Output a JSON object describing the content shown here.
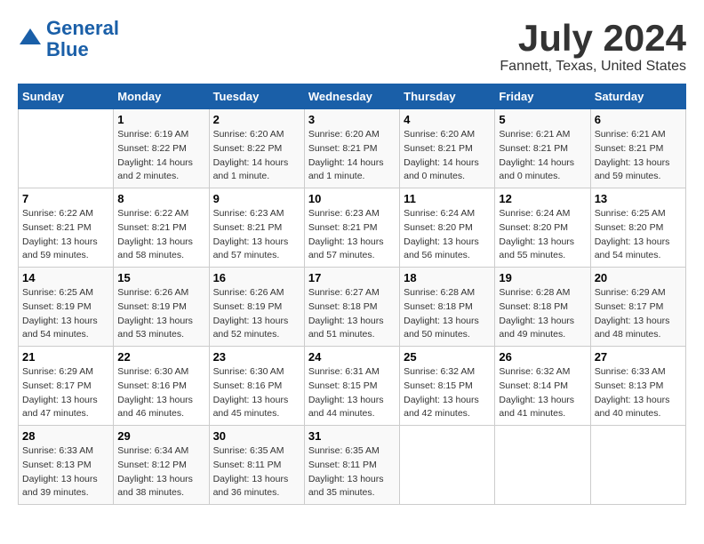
{
  "logo": {
    "line1": "General",
    "line2": "Blue"
  },
  "title": "July 2024",
  "subtitle": "Fannett, Texas, United States",
  "days_of_week": [
    "Sunday",
    "Monday",
    "Tuesday",
    "Wednesday",
    "Thursday",
    "Friday",
    "Saturday"
  ],
  "weeks": [
    [
      {
        "num": "",
        "info": ""
      },
      {
        "num": "1",
        "info": "Sunrise: 6:19 AM\nSunset: 8:22 PM\nDaylight: 14 hours\nand 2 minutes."
      },
      {
        "num": "2",
        "info": "Sunrise: 6:20 AM\nSunset: 8:22 PM\nDaylight: 14 hours\nand 1 minute."
      },
      {
        "num": "3",
        "info": "Sunrise: 6:20 AM\nSunset: 8:21 PM\nDaylight: 14 hours\nand 1 minute."
      },
      {
        "num": "4",
        "info": "Sunrise: 6:20 AM\nSunset: 8:21 PM\nDaylight: 14 hours\nand 0 minutes."
      },
      {
        "num": "5",
        "info": "Sunrise: 6:21 AM\nSunset: 8:21 PM\nDaylight: 14 hours\nand 0 minutes."
      },
      {
        "num": "6",
        "info": "Sunrise: 6:21 AM\nSunset: 8:21 PM\nDaylight: 13 hours\nand 59 minutes."
      }
    ],
    [
      {
        "num": "7",
        "info": "Sunrise: 6:22 AM\nSunset: 8:21 PM\nDaylight: 13 hours\nand 59 minutes."
      },
      {
        "num": "8",
        "info": "Sunrise: 6:22 AM\nSunset: 8:21 PM\nDaylight: 13 hours\nand 58 minutes."
      },
      {
        "num": "9",
        "info": "Sunrise: 6:23 AM\nSunset: 8:21 PM\nDaylight: 13 hours\nand 57 minutes."
      },
      {
        "num": "10",
        "info": "Sunrise: 6:23 AM\nSunset: 8:21 PM\nDaylight: 13 hours\nand 57 minutes."
      },
      {
        "num": "11",
        "info": "Sunrise: 6:24 AM\nSunset: 8:20 PM\nDaylight: 13 hours\nand 56 minutes."
      },
      {
        "num": "12",
        "info": "Sunrise: 6:24 AM\nSunset: 8:20 PM\nDaylight: 13 hours\nand 55 minutes."
      },
      {
        "num": "13",
        "info": "Sunrise: 6:25 AM\nSunset: 8:20 PM\nDaylight: 13 hours\nand 54 minutes."
      }
    ],
    [
      {
        "num": "14",
        "info": "Sunrise: 6:25 AM\nSunset: 8:19 PM\nDaylight: 13 hours\nand 54 minutes."
      },
      {
        "num": "15",
        "info": "Sunrise: 6:26 AM\nSunset: 8:19 PM\nDaylight: 13 hours\nand 53 minutes."
      },
      {
        "num": "16",
        "info": "Sunrise: 6:26 AM\nSunset: 8:19 PM\nDaylight: 13 hours\nand 52 minutes."
      },
      {
        "num": "17",
        "info": "Sunrise: 6:27 AM\nSunset: 8:18 PM\nDaylight: 13 hours\nand 51 minutes."
      },
      {
        "num": "18",
        "info": "Sunrise: 6:28 AM\nSunset: 8:18 PM\nDaylight: 13 hours\nand 50 minutes."
      },
      {
        "num": "19",
        "info": "Sunrise: 6:28 AM\nSunset: 8:18 PM\nDaylight: 13 hours\nand 49 minutes."
      },
      {
        "num": "20",
        "info": "Sunrise: 6:29 AM\nSunset: 8:17 PM\nDaylight: 13 hours\nand 48 minutes."
      }
    ],
    [
      {
        "num": "21",
        "info": "Sunrise: 6:29 AM\nSunset: 8:17 PM\nDaylight: 13 hours\nand 47 minutes."
      },
      {
        "num": "22",
        "info": "Sunrise: 6:30 AM\nSunset: 8:16 PM\nDaylight: 13 hours\nand 46 minutes."
      },
      {
        "num": "23",
        "info": "Sunrise: 6:30 AM\nSunset: 8:16 PM\nDaylight: 13 hours\nand 45 minutes."
      },
      {
        "num": "24",
        "info": "Sunrise: 6:31 AM\nSunset: 8:15 PM\nDaylight: 13 hours\nand 44 minutes."
      },
      {
        "num": "25",
        "info": "Sunrise: 6:32 AM\nSunset: 8:15 PM\nDaylight: 13 hours\nand 42 minutes."
      },
      {
        "num": "26",
        "info": "Sunrise: 6:32 AM\nSunset: 8:14 PM\nDaylight: 13 hours\nand 41 minutes."
      },
      {
        "num": "27",
        "info": "Sunrise: 6:33 AM\nSunset: 8:13 PM\nDaylight: 13 hours\nand 40 minutes."
      }
    ],
    [
      {
        "num": "28",
        "info": "Sunrise: 6:33 AM\nSunset: 8:13 PM\nDaylight: 13 hours\nand 39 minutes."
      },
      {
        "num": "29",
        "info": "Sunrise: 6:34 AM\nSunset: 8:12 PM\nDaylight: 13 hours\nand 38 minutes."
      },
      {
        "num": "30",
        "info": "Sunrise: 6:35 AM\nSunset: 8:11 PM\nDaylight: 13 hours\nand 36 minutes."
      },
      {
        "num": "31",
        "info": "Sunrise: 6:35 AM\nSunset: 8:11 PM\nDaylight: 13 hours\nand 35 minutes."
      },
      {
        "num": "",
        "info": ""
      },
      {
        "num": "",
        "info": ""
      },
      {
        "num": "",
        "info": ""
      }
    ]
  ]
}
